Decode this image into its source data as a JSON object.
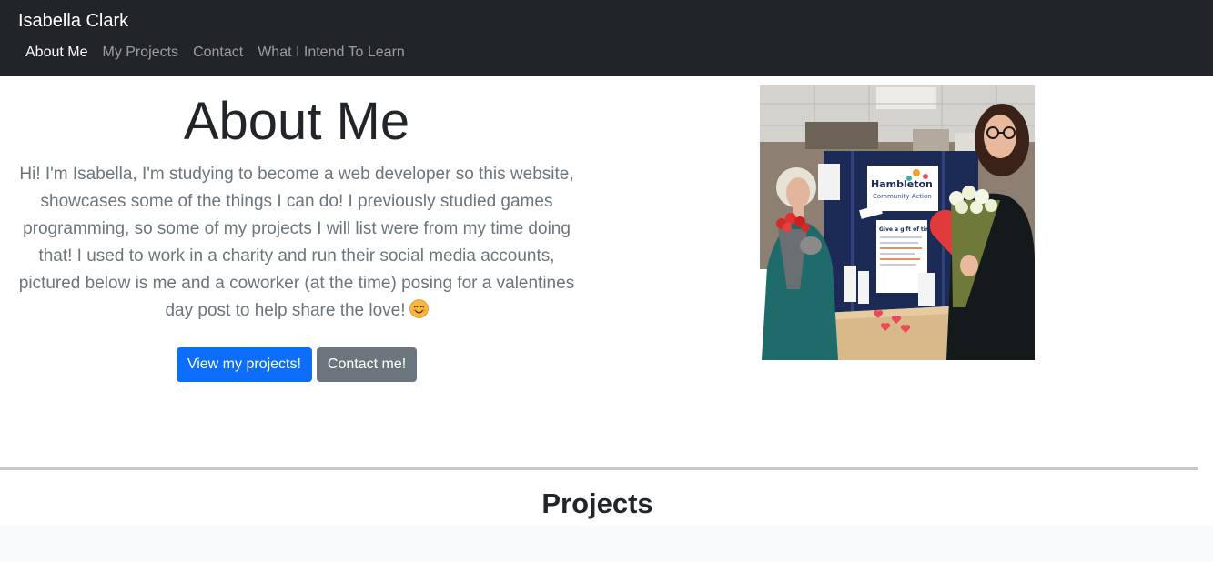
{
  "navbar": {
    "brand": "Isabella Clark",
    "links": [
      {
        "label": "About Me",
        "active": true
      },
      {
        "label": "My Projects",
        "active": false
      },
      {
        "label": "Contact",
        "active": false
      },
      {
        "label": "What I Intend To Learn",
        "active": false
      }
    ]
  },
  "about": {
    "title": "About Me",
    "text": "Hi! I'm Isabella, I'm studying to become a web developer so this website, showcases some of the things I can do! I previously studied games programming, so some of my projects I will list were from my time doing that! I used to work in a charity and run their social media accounts, pictured below is me and a coworker (at the time) posing for a valentines day post to help share the love!",
    "emoji_icon": "smiling-face-icon",
    "buttons": {
      "projects": "View my projects!",
      "contact": "Contact me!"
    }
  },
  "photo": {
    "sign_title": "Hambleton",
    "sign_subtitle": "Community Action",
    "poster_title": "Give a gift of time"
  },
  "projects": {
    "heading": "Projects"
  },
  "colors": {
    "navbar_bg": "#212529",
    "primary": "#0d6efd",
    "secondary": "#6c757d"
  }
}
